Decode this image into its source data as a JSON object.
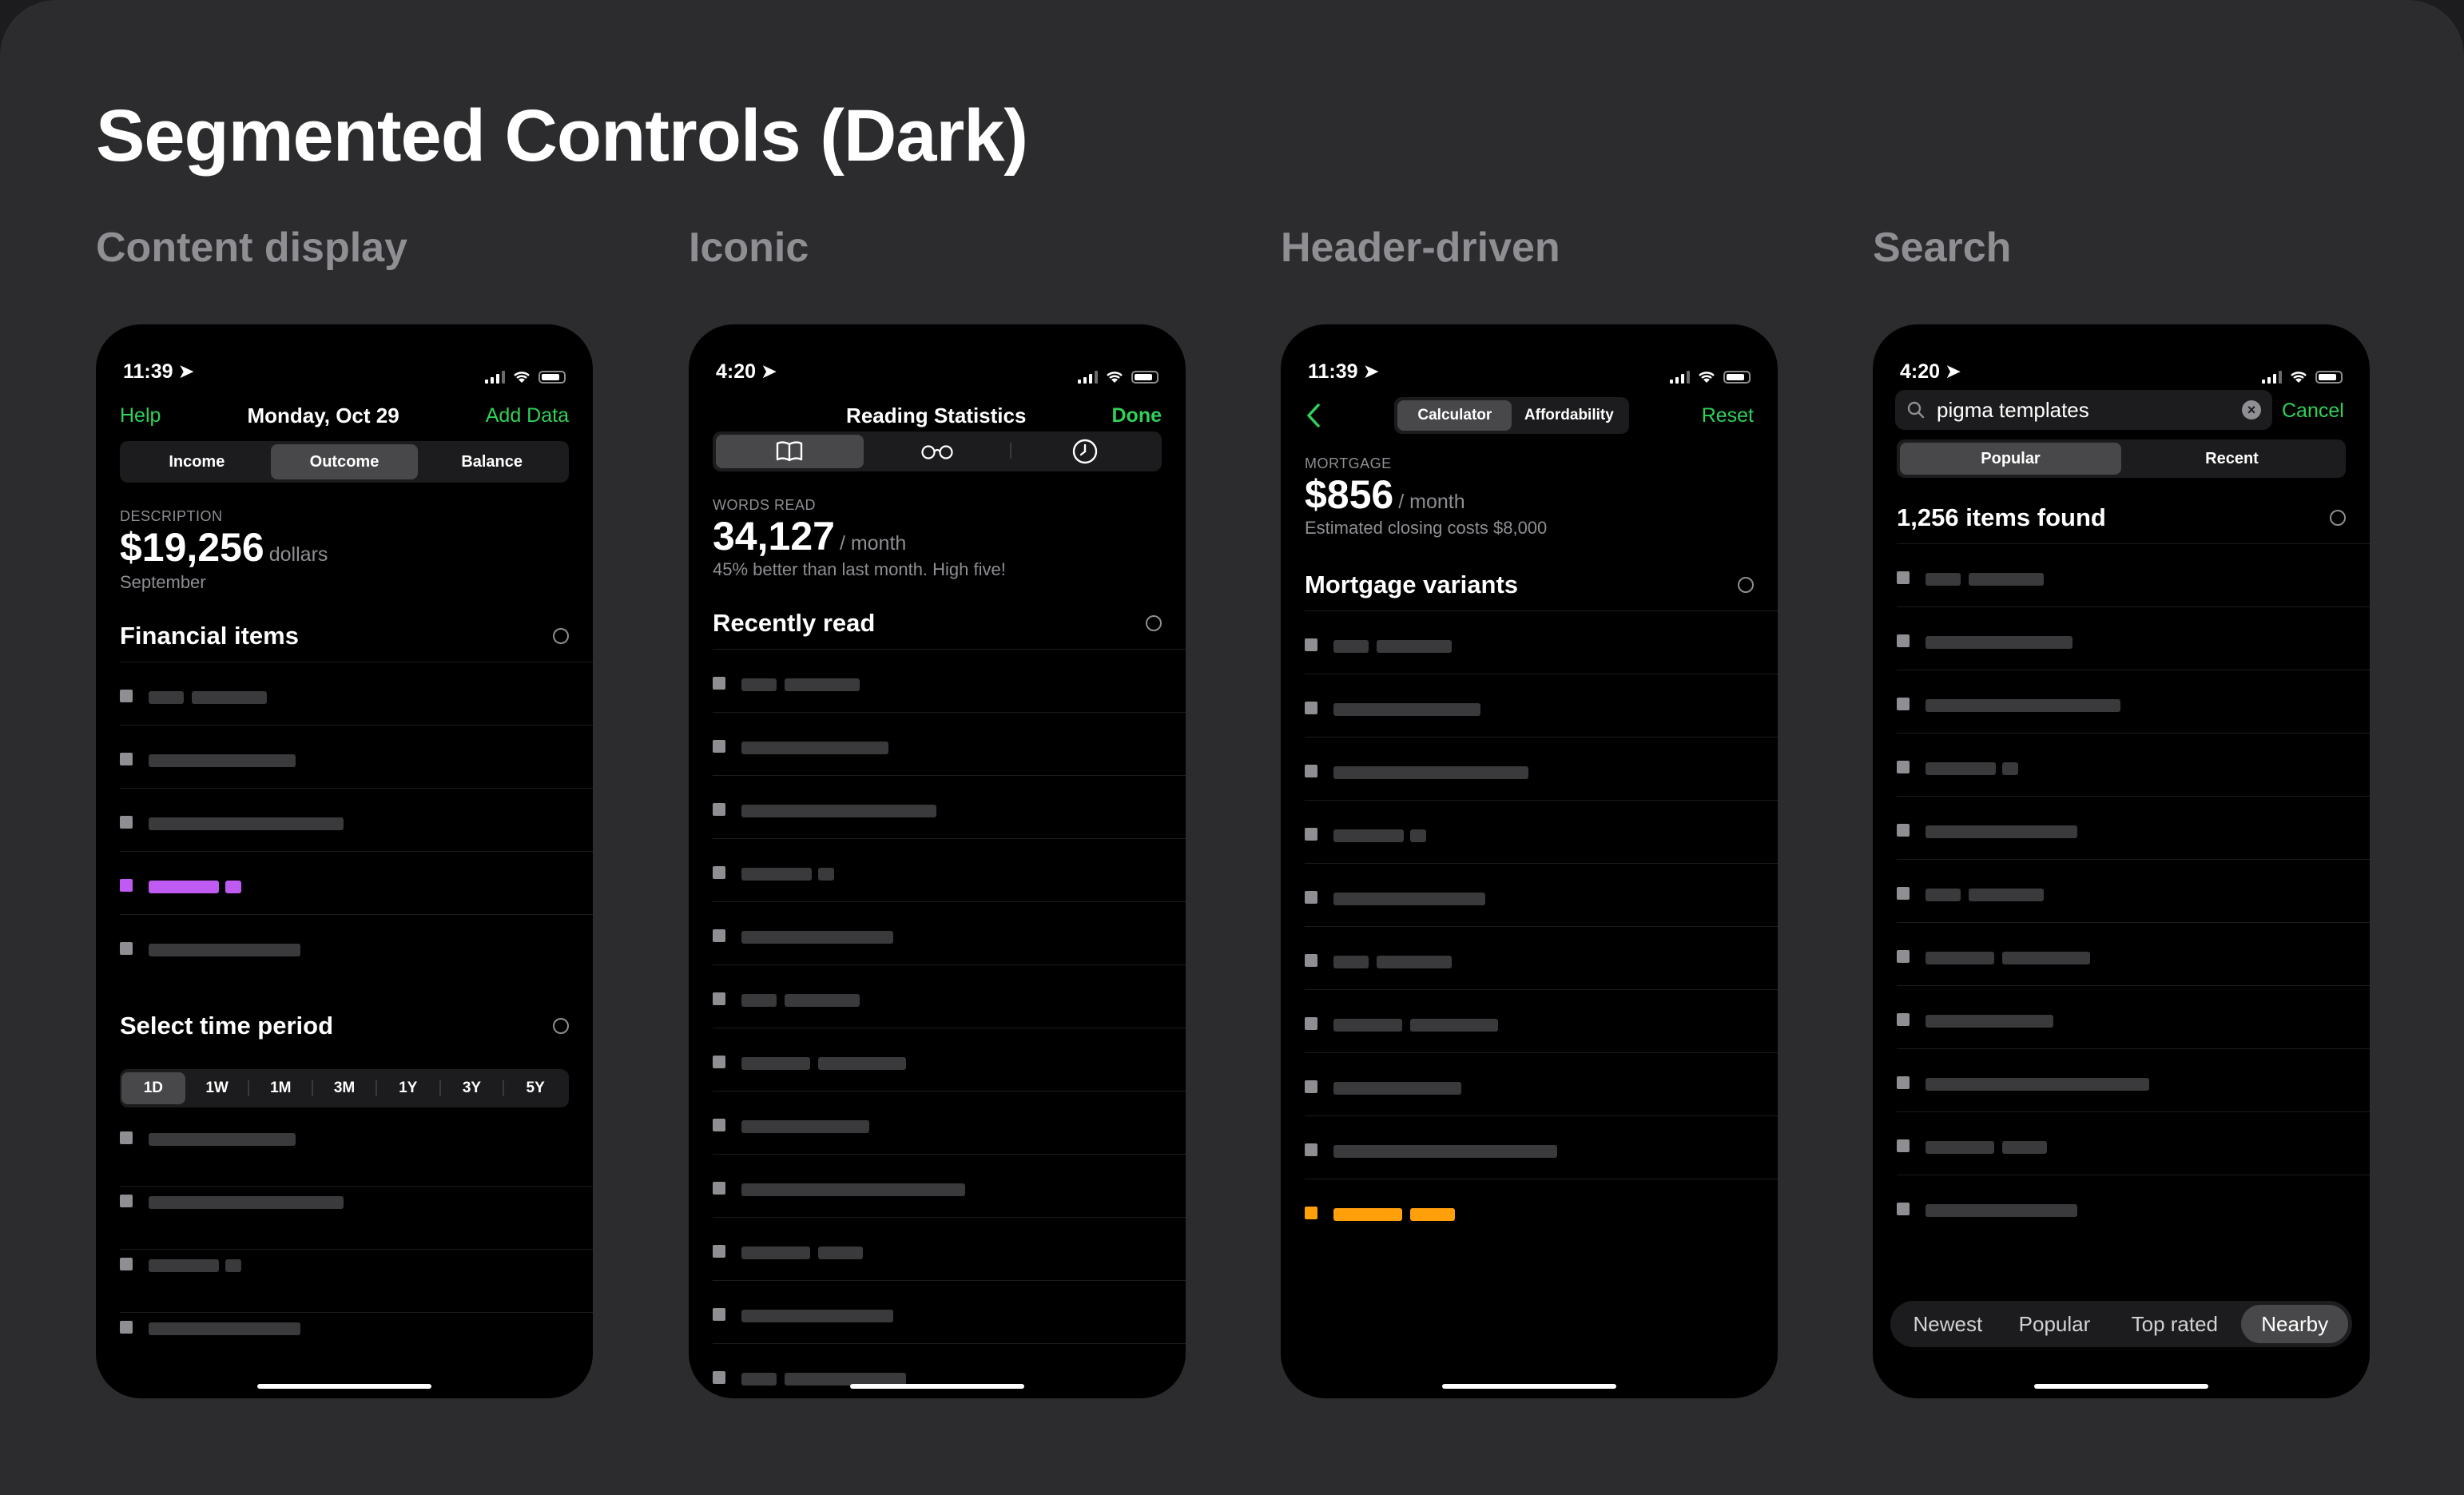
{
  "page": {
    "title": "Segmented Controls (Dark)"
  },
  "colors": {
    "accent_green": "#30d158",
    "highlight_purple": "#bf5af2",
    "highlight_orange": "#ff9f0a"
  },
  "columns": [
    {
      "title": "Content display",
      "status_time": "11:39",
      "nav": {
        "left": "Help",
        "title": "Monday, Oct 29",
        "right": "Add Data"
      },
      "segments": [
        "Income",
        "Outcome",
        "Balance"
      ],
      "active_segment": "Outcome",
      "label": "DESCRIPTION",
      "value": "$19,256",
      "unit": "dollars",
      "sub": "September",
      "section": "Financial items",
      "section2": "Select time period",
      "periods": [
        "1D",
        "1W",
        "1M",
        "3M",
        "1Y",
        "3Y",
        "5Y"
      ],
      "active_period": "1D"
    },
    {
      "title": "Iconic",
      "status_time": "4:20",
      "nav": {
        "title": "Reading Statistics",
        "right": "Done"
      },
      "icons": [
        "book-icon",
        "glasses-icon",
        "clock-icon"
      ],
      "active_icon": "book-icon",
      "label": "WORDS READ",
      "value": "34,127",
      "unit": "/ month",
      "sub": "45% better than last month. High five!",
      "section": "Recently read"
    },
    {
      "title": "Header-driven",
      "status_time": "11:39",
      "nav": {
        "left_icon": "chevron-left-icon",
        "right": "Reset"
      },
      "segments": [
        "Calculator",
        "Affordability"
      ],
      "active_segment": "Calculator",
      "label": "MORTGAGE",
      "value": "$856",
      "unit": "/ month",
      "sub": "Estimated closing costs $8,000",
      "section": "Mortgage variants"
    },
    {
      "title": "Search",
      "status_time": "4:20",
      "search": {
        "value": "pigma templates",
        "cancel": "Cancel"
      },
      "segments": [
        "Popular",
        "Recent"
      ],
      "active_segment": "Popular",
      "section": "1,256 items found",
      "bottom_segments": [
        "Newest",
        "Popular",
        "Top rated",
        "Nearby"
      ],
      "active_bottom": "Nearby"
    }
  ]
}
